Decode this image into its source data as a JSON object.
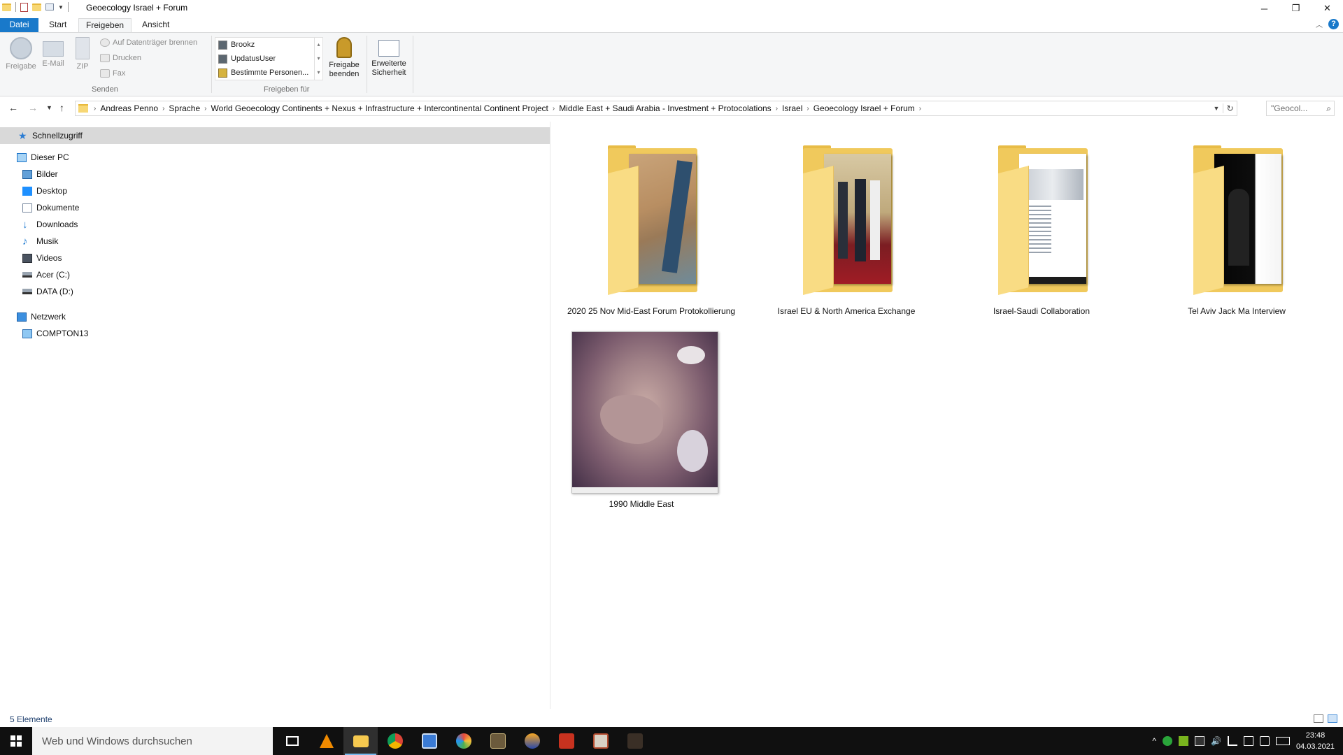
{
  "window": {
    "title": "Geoecology Israel + Forum",
    "minimize_icon": "minimize-icon",
    "maximize_icon": "restore-icon",
    "close_icon": "close-icon"
  },
  "tabs": {
    "datei": "Datei",
    "start": "Start",
    "freigeben": "Freigeben",
    "ansicht": "Ansicht"
  },
  "ribbon": {
    "freigabe": "Freigabe",
    "email": "E-Mail",
    "zip": "ZIP",
    "burn": "Auf Datenträger brennen",
    "print": "Drucken",
    "fax": "Fax",
    "group_senden": "Senden",
    "users": [
      "Brookz",
      "UpdatusUser",
      "Bestimmte Personen..."
    ],
    "group_freigeben_fuer": "Freigeben für",
    "stop_sharing_line1": "Freigabe",
    "stop_sharing_line2": "beenden",
    "advanced_line1": "Erweiterte",
    "advanced_line2": "Sicherheit"
  },
  "address": {
    "crumbs": [
      "Andreas Penno",
      "Sprache",
      "World Geoecology Continents + Nexus + Infrastructure + Intercontinental Continent Project",
      "Middle East + Saudi Arabia - Investment + Protocolations",
      "Israel",
      "Geoecology Israel + Forum"
    ],
    "search_placeholder": "\"Geocol..."
  },
  "nav": {
    "quick_access": "Schnellzugriff",
    "this_pc": "Dieser PC",
    "pictures": "Bilder",
    "desktop": "Desktop",
    "documents": "Dokumente",
    "downloads": "Downloads",
    "music": "Musik",
    "videos": "Videos",
    "drive_c": "Acer (C:)",
    "drive_d": "DATA (D:)",
    "network": "Netzwerk",
    "computer": "COMPTON13"
  },
  "items": [
    {
      "label": "2020 25 Nov Mid-East Forum Protokollierung",
      "type": "folder"
    },
    {
      "label": "Israel EU & North America Exchange",
      "type": "folder"
    },
    {
      "label": "Israel-Saudi Collaboration",
      "type": "folder"
    },
    {
      "label": "Tel Aviv Jack Ma Interview",
      "type": "folder"
    },
    {
      "label": "1990 Middle East",
      "type": "image"
    }
  ],
  "status": {
    "count": "5 Elemente"
  },
  "taskbar": {
    "search_placeholder": "Web und Windows durchsuchen",
    "time": "23:48",
    "date": "04.03.2021"
  },
  "colors": {
    "accent": "#1979ca",
    "folder": "#f0c95c",
    "taskbar": "#101010"
  }
}
